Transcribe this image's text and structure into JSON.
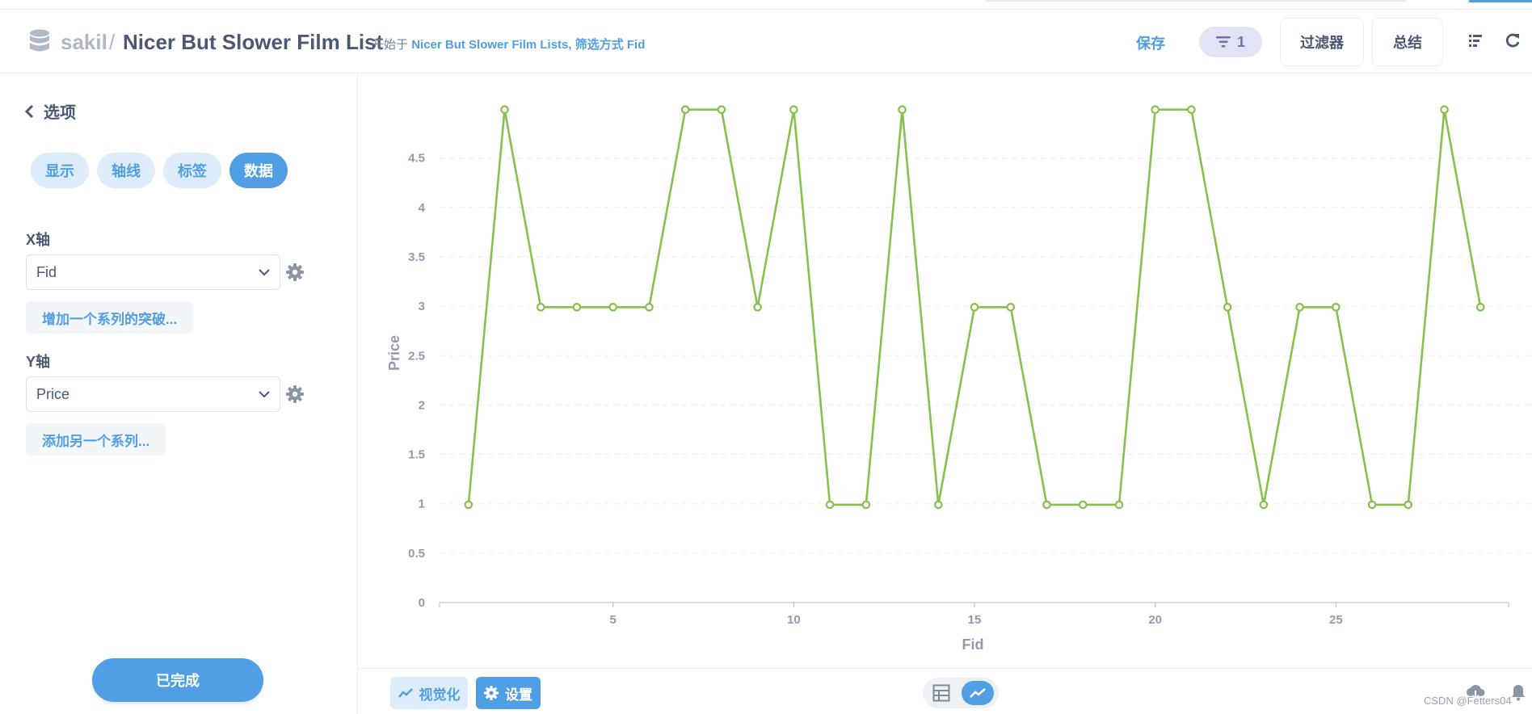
{
  "header": {
    "db_name": "sakil",
    "separator": "/",
    "title": "Nicer But Slower Film List",
    "subtitle_prefix": "开始于",
    "subtitle_source": "Nicer But Slower Film Lists, 筛选方式 Fid",
    "save_label": "保存",
    "filter_count": "1",
    "filter_label": "过滤器",
    "summarize_label": "总结"
  },
  "sidebar": {
    "back_label": "选项",
    "tabs": [
      {
        "label": "显示",
        "active": false
      },
      {
        "label": "轴线",
        "active": false
      },
      {
        "label": "标签",
        "active": false
      },
      {
        "label": "数据",
        "active": true
      }
    ],
    "x_axis_label": "X轴",
    "x_axis_value": "Fid",
    "x_add_label": "增加一个系列的突破...",
    "y_axis_label": "Y轴",
    "y_axis_value": "Price",
    "y_add_label": "添加另一个系列...",
    "done_label": "已完成"
  },
  "footer": {
    "viz_label": "视觉化",
    "settings_label": "设置",
    "watermark": "CSDN @Fetters04"
  },
  "colors": {
    "accent": "#509ee3",
    "series": "#88bf4d",
    "text": "#4c5773"
  },
  "chart_data": {
    "type": "line",
    "xlabel": "Fid",
    "ylabel": "Price",
    "x": [
      1,
      2,
      3,
      4,
      5,
      6,
      7,
      8,
      9,
      10,
      11,
      12,
      13,
      14,
      15,
      16,
      17,
      18,
      19,
      20,
      21,
      22,
      23,
      24,
      25,
      26,
      27,
      28,
      29
    ],
    "series": [
      {
        "values": [
          0.99,
          4.99,
          2.99,
          2.99,
          2.99,
          2.99,
          4.99,
          4.99,
          2.99,
          4.99,
          0.99,
          0.99,
          4.99,
          0.99,
          2.99,
          2.99,
          0.99,
          0.99,
          0.99,
          4.99,
          4.99,
          2.99,
          0.99,
          2.99,
          2.99,
          0.99,
          0.99,
          4.99,
          2.99
        ]
      }
    ],
    "x_ticks": [
      5,
      10,
      15,
      20,
      25
    ],
    "y_ticks": [
      0,
      0.5,
      1,
      1.5,
      2,
      2.5,
      3,
      3.5,
      4,
      4.5
    ],
    "ylim": [
      0,
      5
    ],
    "grid": "horizontal dashed"
  }
}
